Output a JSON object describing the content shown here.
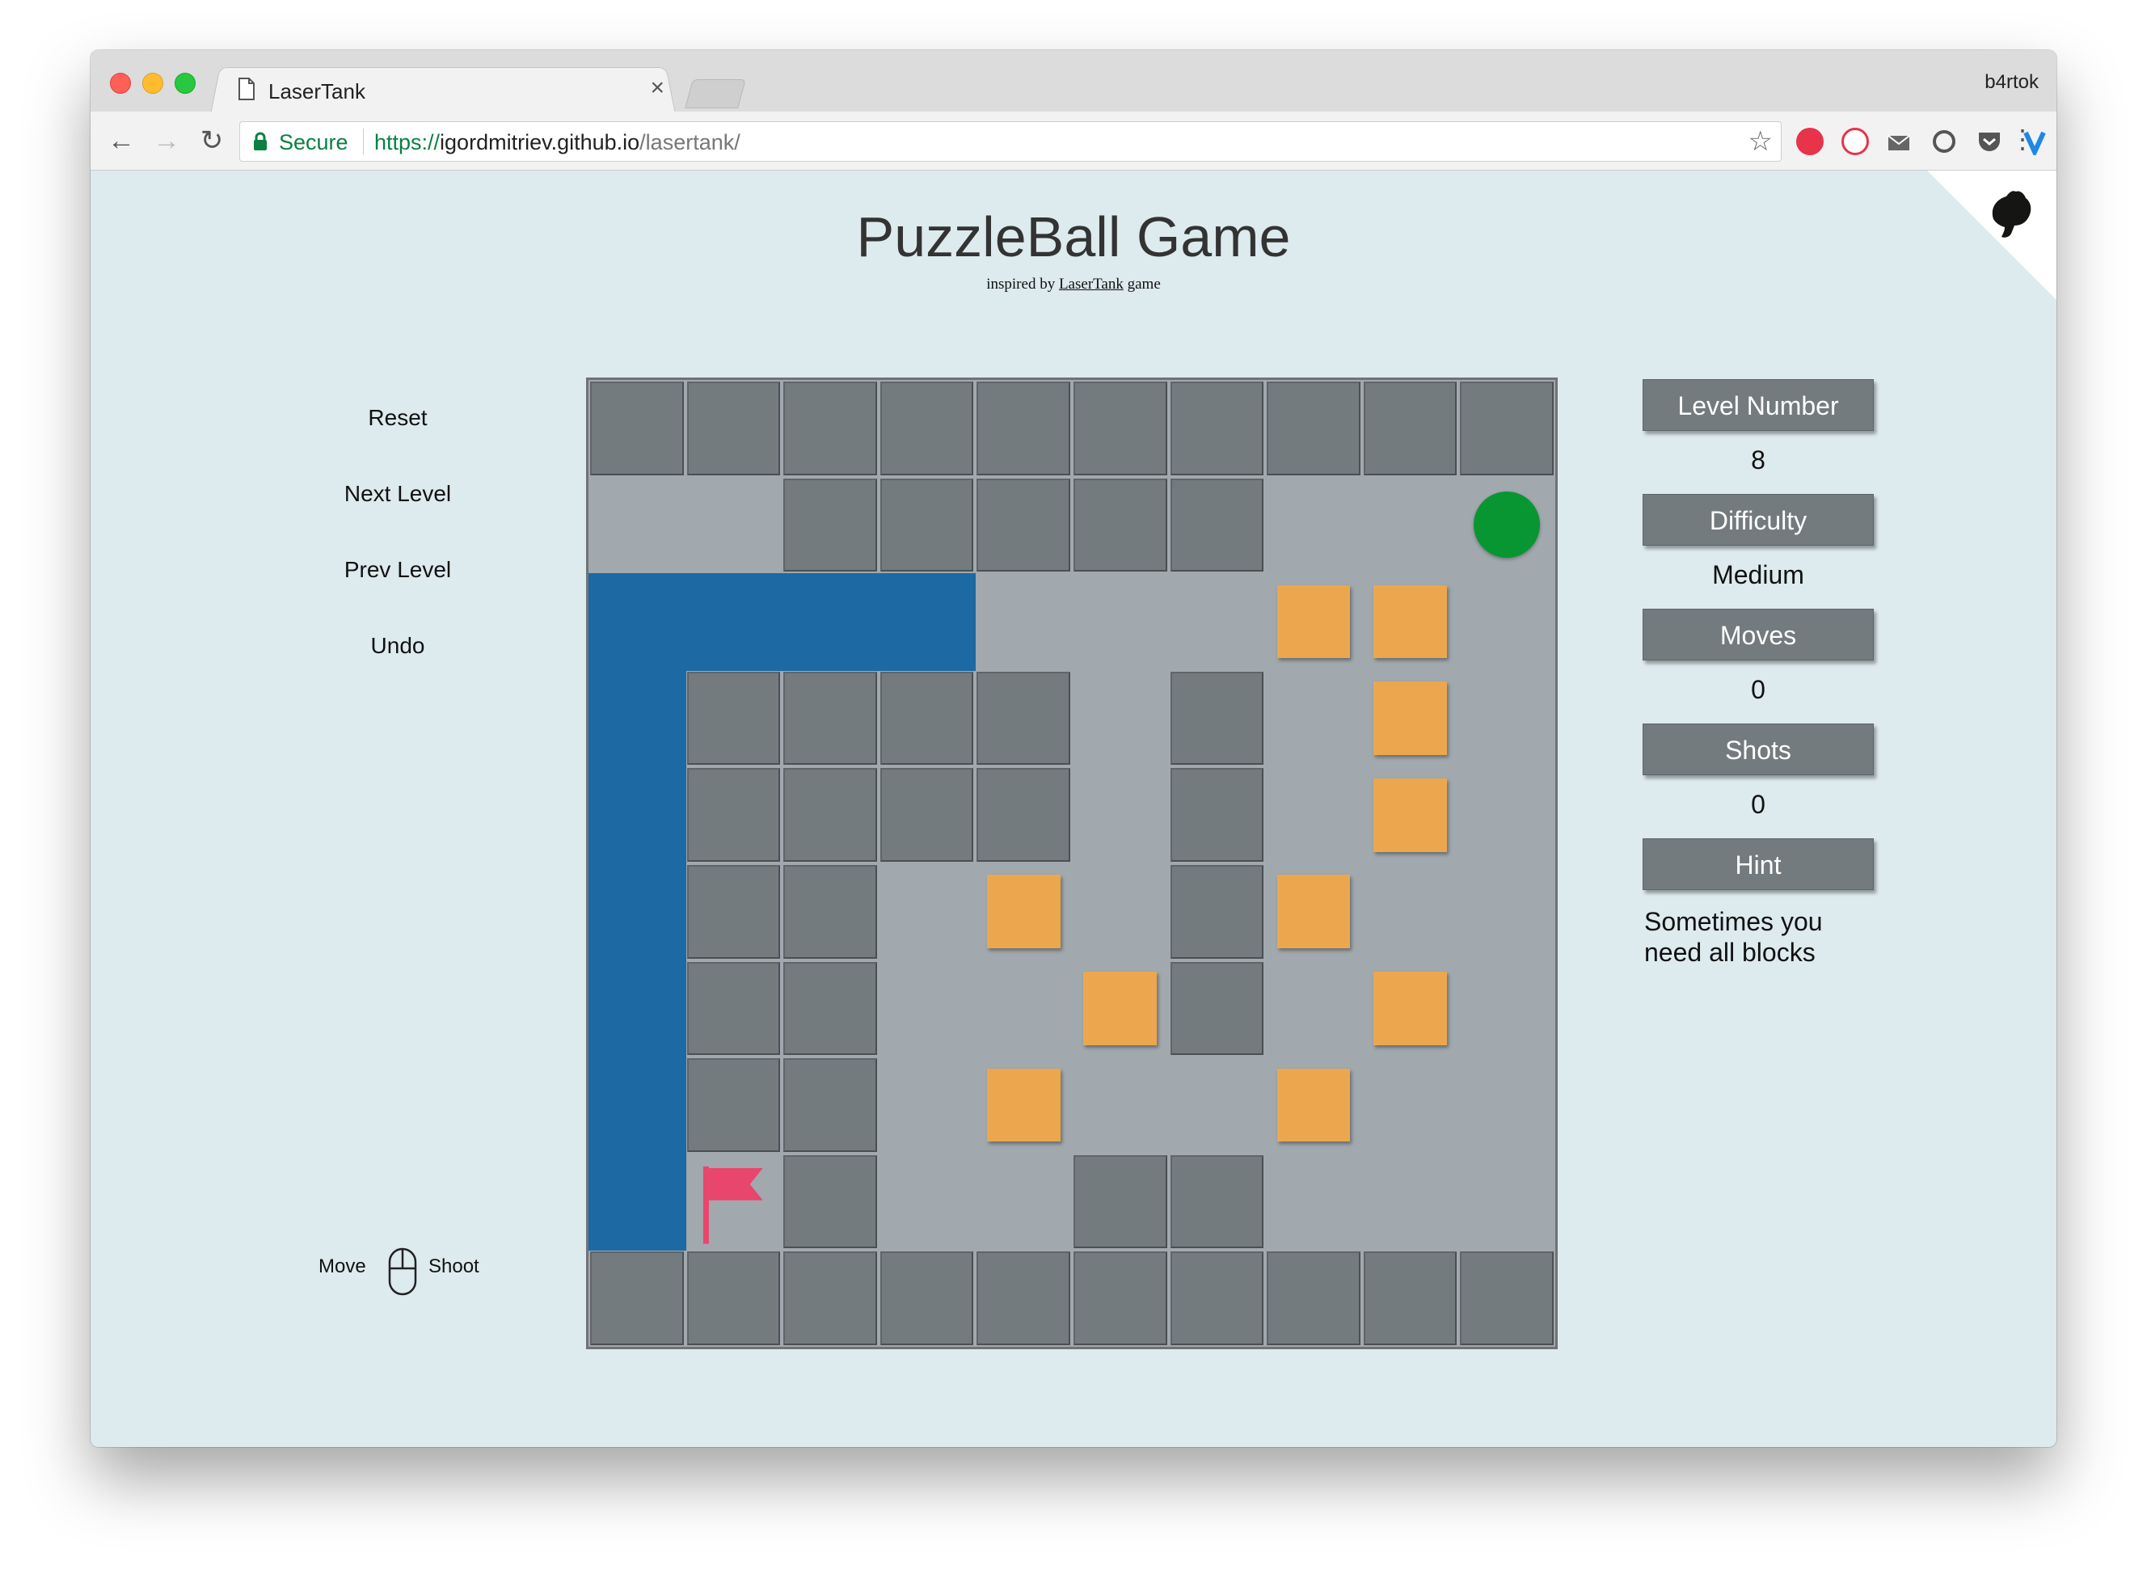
{
  "browser": {
    "tab_title": "LaserTank",
    "tab_close": "×",
    "profile_name": "b4rtok",
    "secure_label": "Secure",
    "url_scheme": "https://",
    "url_host": "igordmitriev.github.io",
    "url_path": "/lasertank/",
    "back": "←",
    "forward": "→",
    "reload": "↻",
    "star": "☆",
    "menu": "⋮",
    "extensions": [
      "red-circle-icon",
      "adblock-icon",
      "mail-icon",
      "sync-icon",
      "pocket-icon",
      "vee-icon"
    ]
  },
  "page": {
    "title": "PuzzleBall Game",
    "subtitle_prefix": "inspired by ",
    "subtitle_link": "LaserTank",
    "subtitle_suffix": " game"
  },
  "controls": {
    "reset": "Reset",
    "next_level": "Next Level",
    "prev_level": "Prev Level",
    "undo": "Undo",
    "move_label": "Move",
    "shoot_label": "Shoot"
  },
  "info": {
    "level_label": "Level Number",
    "level_value": "8",
    "difficulty_label": "Difficulty",
    "difficulty_value": "Medium",
    "moves_label": "Moves",
    "moves_value": "0",
    "shots_label": "Shots",
    "shots_value": "0",
    "hint_label": "Hint",
    "hint_text": "Sometimes you need all blocks"
  },
  "colors": {
    "page_bg": "#ddeaee",
    "floor": "#a1a8ae",
    "wall": "#737b7e",
    "water": "#1d69a4",
    "block": "#eca74e",
    "ball": "#089632",
    "flag": "#e8466c"
  },
  "board": {
    "rows": 10,
    "cols": 10,
    "legend": "W=wall, ~=water, B=block, O=ball, F=flag, .=floor",
    "grid": [
      "WWWWWWWWWW",
      "..WWWWW..O",
      "~~~~...BB.",
      "~WWWW.W.B.",
      "~WWWW.W.B.",
      "~WW.B.WB..",
      "~WW..BW.B.",
      "~WW.B..B..",
      "~FW..WW...",
      "WWWWWWWWWW"
    ]
  }
}
